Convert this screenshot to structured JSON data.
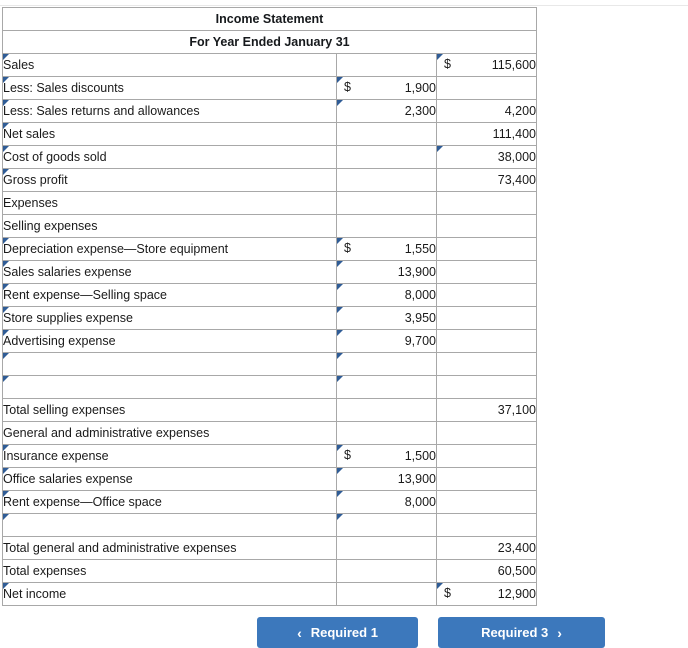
{
  "statement": {
    "title": "Income Statement",
    "period": "For Year Ended January 31",
    "currency_symbol": "$",
    "rows": [
      {
        "label": "Sales",
        "indent": 0,
        "label_pick": true,
        "mid": "",
        "mid_cur": "",
        "mid_pick": false,
        "right": "115,600",
        "right_cur": "$",
        "right_pick": true
      },
      {
        "label": "Less: Sales discounts",
        "indent": 0,
        "label_pick": true,
        "mid": "1,900",
        "mid_cur": "$",
        "mid_pick": true,
        "right": "",
        "right_cur": "",
        "right_pick": false
      },
      {
        "label": "Less: Sales returns and allowances",
        "indent": 0,
        "label_pick": true,
        "mid": "2,300",
        "mid_cur": "",
        "mid_pick": true,
        "right": "4,200",
        "right_cur": "",
        "right_pick": false
      },
      {
        "label": "Net sales",
        "indent": 0,
        "label_pick": true,
        "mid": "",
        "mid_cur": "",
        "mid_pick": false,
        "right": "111,400",
        "right_cur": "",
        "right_pick": false,
        "right_rule_top": true
      },
      {
        "label": "Cost of goods sold",
        "indent": 0,
        "label_pick": true,
        "mid": "",
        "mid_cur": "",
        "mid_pick": false,
        "right": "38,000",
        "right_cur": "",
        "right_pick": true
      },
      {
        "label": "Gross profit",
        "indent": 0,
        "label_pick": true,
        "mid": "",
        "mid_cur": "",
        "mid_pick": false,
        "right": "73,400",
        "right_cur": "",
        "right_pick": false
      },
      {
        "label": "Expenses",
        "indent": 0,
        "label_pick": false,
        "mid": "",
        "mid_cur": "",
        "mid_pick": false,
        "right": "",
        "right_cur": "",
        "right_pick": false
      },
      {
        "label": "Selling expenses",
        "indent": 1,
        "label_pick": false,
        "mid": "",
        "mid_cur": "",
        "mid_pick": false,
        "right": "",
        "right_cur": "",
        "right_pick": false
      },
      {
        "label": "Depreciation expense—Store equipment",
        "indent": 2,
        "label_pick": true,
        "mid": "1,550",
        "mid_cur": "$",
        "mid_pick": true,
        "right": "",
        "right_cur": "",
        "right_pick": false
      },
      {
        "label": "Sales salaries expense",
        "indent": 2,
        "label_pick": true,
        "mid": "13,900",
        "mid_cur": "",
        "mid_pick": true,
        "right": "",
        "right_cur": "",
        "right_pick": false
      },
      {
        "label": "Rent expense—Selling space",
        "indent": 2,
        "label_pick": true,
        "mid": "8,000",
        "mid_cur": "",
        "mid_pick": true,
        "right": "",
        "right_cur": "",
        "right_pick": false
      },
      {
        "label": "Store supplies expense",
        "indent": 2,
        "label_pick": true,
        "mid": "3,950",
        "mid_cur": "",
        "mid_pick": true,
        "right": "",
        "right_cur": "",
        "right_pick": false
      },
      {
        "label": "Advertising expense",
        "indent": 2,
        "label_pick": true,
        "mid": "9,700",
        "mid_cur": "",
        "mid_pick": true,
        "right": "",
        "right_cur": "",
        "right_pick": false
      },
      {
        "label": "",
        "indent": 2,
        "label_pick": true,
        "mid": "",
        "mid_cur": "",
        "mid_pick": true,
        "right": "",
        "right_cur": "",
        "right_pick": false
      },
      {
        "label": "",
        "indent": 2,
        "label_pick": true,
        "mid": "",
        "mid_cur": "",
        "mid_pick": true,
        "right": "",
        "right_cur": "",
        "right_pick": false,
        "mid_rule_bot": true
      },
      {
        "label": "Total selling expenses",
        "indent": 1,
        "label_pick": false,
        "mid": "",
        "mid_cur": "",
        "mid_pick": false,
        "right": "37,100",
        "right_cur": "",
        "right_pick": false
      },
      {
        "label": "General and administrative expenses",
        "indent": 1,
        "label_pick": false,
        "mid": "",
        "mid_cur": "",
        "mid_pick": false,
        "right": "",
        "right_cur": "",
        "right_pick": false
      },
      {
        "label": "Insurance expense",
        "indent": 2,
        "label_pick": true,
        "mid": "1,500",
        "mid_cur": "$",
        "mid_pick": true,
        "right": "",
        "right_cur": "",
        "right_pick": false
      },
      {
        "label": "Office salaries expense",
        "indent": 2,
        "label_pick": true,
        "mid": "13,900",
        "mid_cur": "",
        "mid_pick": true,
        "right": "",
        "right_cur": "",
        "right_pick": false
      },
      {
        "label": "Rent expense—Office space",
        "indent": 2,
        "label_pick": true,
        "mid": "8,000",
        "mid_cur": "",
        "mid_pick": true,
        "right": "",
        "right_cur": "",
        "right_pick": false
      },
      {
        "label": "",
        "indent": 2,
        "label_pick": true,
        "mid": "",
        "mid_cur": "",
        "mid_pick": true,
        "right": "",
        "right_cur": "",
        "right_pick": false,
        "mid_rule_bot": true
      },
      {
        "label": "Total general and administrative expenses",
        "indent": 1,
        "label_pick": false,
        "mid": "",
        "mid_cur": "",
        "mid_pick": false,
        "right": "23,400",
        "right_cur": "",
        "right_pick": false
      },
      {
        "label": "Total expenses",
        "indent": 1,
        "label_pick": false,
        "mid": "",
        "mid_cur": "",
        "mid_pick": false,
        "right": "60,500",
        "right_cur": "",
        "right_pick": false,
        "right_rule_top": true
      },
      {
        "label": "Net income",
        "indent": 0,
        "label_pick": true,
        "mid": "",
        "mid_cur": "",
        "mid_pick": false,
        "right": "12,900",
        "right_cur": "$",
        "right_pick": true
      }
    ]
  },
  "footer": {
    "prev_label": "Required 1",
    "next_label": "Required 3",
    "prev_icon": "chevron-left-icon",
    "next_icon": "chevron-right-icon",
    "prev_chevron": "‹",
    "next_chevron": "›",
    "button_color": "#3c78bc"
  },
  "theme": {
    "header_band": "#74a9e0",
    "pick_outline": "#5b8cc0",
    "grid_line": "#a8a8a8"
  }
}
